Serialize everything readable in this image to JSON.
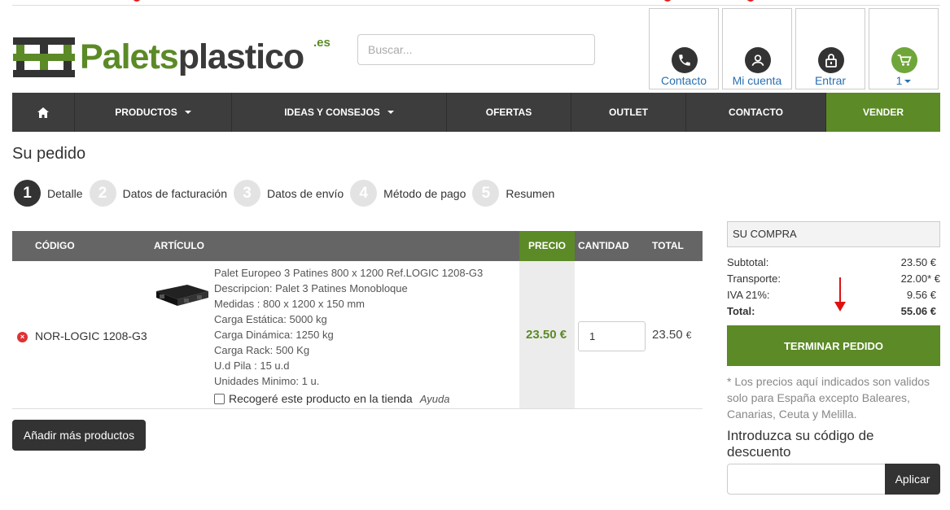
{
  "header": {
    "logo": {
      "part1": "Palets",
      "part2": "plastico",
      "tld": ".es"
    },
    "search": {
      "placeholder": "Buscar..."
    },
    "boxes": [
      {
        "label": "Contacto",
        "icon": "phone-icon"
      },
      {
        "label": "Mi cuenta",
        "icon": "user-icon"
      },
      {
        "label": "Entrar",
        "icon": "lock-icon"
      },
      {
        "label": "1",
        "icon": "cart-icon"
      }
    ]
  },
  "nav": {
    "items": [
      {
        "label": "",
        "icon": "home-icon"
      },
      {
        "label": "PRODUCTOS"
      },
      {
        "label": "IDEAS Y CONSEJOS"
      },
      {
        "label": "OFERTAS"
      },
      {
        "label": "OUTLET"
      },
      {
        "label": "CONTACTO"
      },
      {
        "label": "VENDER"
      }
    ]
  },
  "page": {
    "title": "Su pedido"
  },
  "steps": [
    {
      "num": "1",
      "label": "Detalle"
    },
    {
      "num": "2",
      "label": "Datos de facturación"
    },
    {
      "num": "3",
      "label": "Datos de envío"
    },
    {
      "num": "4",
      "label": "Método de pago"
    },
    {
      "num": "5",
      "label": "Resumen"
    }
  ],
  "table": {
    "headers": {
      "code": "CÓDIGO",
      "article": "ARTÍCULO",
      "price": "PRECIO",
      "qty": "CANTIDAD",
      "total": "TOTAL"
    },
    "row": {
      "code": "NOR-LOGIC 1208-G3",
      "desc": [
        "Palet Europeo 3 Patines 800 x 1200 Ref.LOGIC 1208-G3",
        "Descripcion: Palet 3 Patines Monobloque",
        "Medidas : 800 x 1200 x 150 mm",
        "Carga Estática: 5000 kg",
        "Carga Dinámica: 1250 kg",
        "Carga Rack: 500 Kg",
        "U.d Pila : 15 u.d",
        "Unidades Minimo: 1 u."
      ],
      "pickup": "Recogeré este producto en la tienda",
      "help": "Ayuda",
      "price": "23.50 €",
      "qty": "1",
      "total": "23.50",
      "total_currency": "€"
    }
  },
  "actions": {
    "add_more": "Añadir más productos"
  },
  "summary": {
    "title": "SU COMPRA",
    "subtotal_label": "Subtotal:",
    "subtotal": "23.50 €",
    "shipping_label": "Transporte:",
    "shipping": "22.00* €",
    "tax_label": "IVA 21%:",
    "tax": "9.56 €",
    "total_label": "Total:",
    "total": "55.06 €",
    "finish": "TERMINAR PEDIDO",
    "note": "* Los precios aquí indicados son validos solo para España excepto Baleares, Canarias, Ceuta y Melilla.",
    "discount_title": "Introduzca su código de descuento",
    "apply": "Aplicar"
  },
  "colors": {
    "brand_green": "#5b8a26",
    "nav_dark": "#3d3d3d",
    "link_blue": "#2a6fb0"
  }
}
